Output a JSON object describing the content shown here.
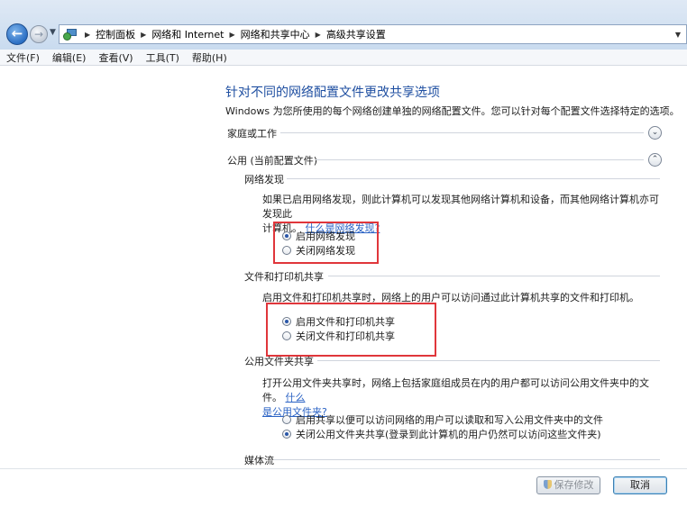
{
  "breadcrumb": [
    "控制面板",
    "网络和 Internet",
    "网络和共享中心",
    "高级共享设置"
  ],
  "menu": [
    "文件(F)",
    "编辑(E)",
    "查看(V)",
    "工具(T)",
    "帮助(H)"
  ],
  "page": {
    "title": "针对不同的网络配置文件更改共享选项",
    "description": "Windows 为您所使用的每个网络创建单独的网络配置文件。您可以针对每个配置文件选择特定的选项。"
  },
  "profiles": {
    "home": "家庭或工作",
    "public": "公用 (当前配置文件)"
  },
  "network_discovery": {
    "heading": "网络发现",
    "text": "如果已启用网络发现，则此计算机可以发现其他网络计算机和设备，而其他网络计算机亦可发现此",
    "text2": "计算机。",
    "link": "什么是网络发现?",
    "on": "启用网络发现",
    "off": "关闭网络发现"
  },
  "file_printer": {
    "heading": "文件和打印机共享",
    "text": "启用文件和打印机共享时，网络上的用户可以访问通过此计算机共享的文件和打印机。",
    "on": "启用文件和打印机共享",
    "off": "关闭文件和打印机共享"
  },
  "public_folder": {
    "heading": "公用文件夹共享",
    "text": "打开公用文件夹共享时，网络上包括家庭组成员在内的用户都可以访问公用文件夹中的文件。",
    "link_a": "什么",
    "link_b": "是公用文件夹?",
    "on": "启用共享以便可以访问网络的用户可以读取和写入公用文件夹中的文件",
    "off": "关闭公用文件夹共享(登录到此计算机的用户仍然可以访问这些文件夹)"
  },
  "media": {
    "heading": "媒体流"
  },
  "buttons": {
    "save": "保存修改",
    "cancel": "取消"
  }
}
